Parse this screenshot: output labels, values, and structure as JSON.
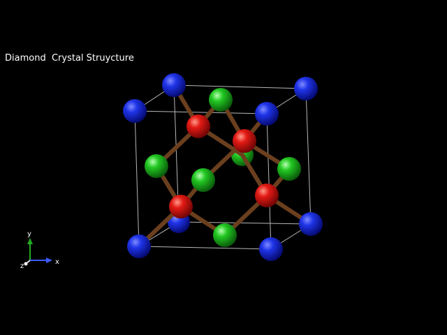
{
  "viewer": {
    "title": "Diamond  Crystal Struycture",
    "colors": {
      "background": "#000000",
      "corner_atom": "#1426d8",
      "face_center_atom": "#22c022",
      "tetrahedral_atom": "#e01818",
      "bond": "#6b3f1e",
      "cell_edge": "#d8d8d8"
    },
    "axes": {
      "x_label": "x",
      "y_label": "y",
      "z_label": "z",
      "x_color": "#3a5bff",
      "y_color": "#22aa22",
      "z_color": "#dddddd"
    },
    "atoms": {
      "corner_count": 8,
      "face_center_count": 6,
      "tetrahedral_count": 4
    }
  }
}
